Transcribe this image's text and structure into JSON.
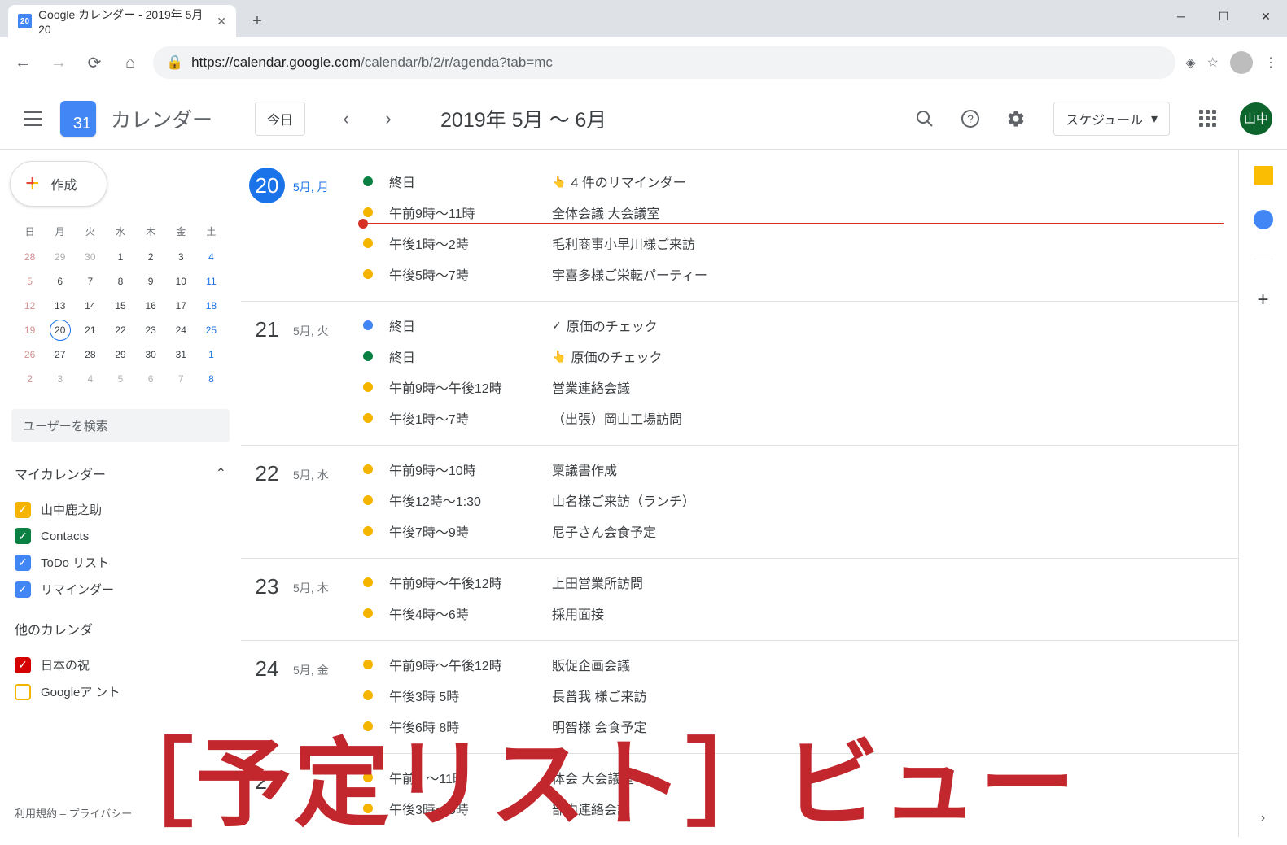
{
  "browser": {
    "tab_title": "Google カレンダー - 2019年 5月 20",
    "favicon_text": "20",
    "url_host": "https://calendar.google.com",
    "url_path": "/calendar/b/2/r/agenda?tab=mc"
  },
  "header": {
    "logo_day": "31",
    "logo_text": "カレンダー",
    "today": "今日",
    "date_range": "2019年 5月 ～ 6月",
    "view_label": "スケジュール",
    "avatar_text": "山中"
  },
  "sidebar": {
    "create": "作成",
    "mini_cal": {
      "dow": [
        "日",
        "月",
        "火",
        "水",
        "木",
        "金",
        "土"
      ],
      "weeks": [
        [
          {
            "d": "28",
            "cls": "sun-other"
          },
          {
            "d": "29",
            "cls": "other"
          },
          {
            "d": "30",
            "cls": "other"
          },
          {
            "d": "1",
            "cls": ""
          },
          {
            "d": "2",
            "cls": ""
          },
          {
            "d": "3",
            "cls": ""
          },
          {
            "d": "4",
            "cls": "sat"
          }
        ],
        [
          {
            "d": "5",
            "cls": "sun-other"
          },
          {
            "d": "6",
            "cls": ""
          },
          {
            "d": "7",
            "cls": ""
          },
          {
            "d": "8",
            "cls": ""
          },
          {
            "d": "9",
            "cls": ""
          },
          {
            "d": "10",
            "cls": ""
          },
          {
            "d": "11",
            "cls": "sat"
          }
        ],
        [
          {
            "d": "12",
            "cls": "sun-other"
          },
          {
            "d": "13",
            "cls": ""
          },
          {
            "d": "14",
            "cls": ""
          },
          {
            "d": "15",
            "cls": ""
          },
          {
            "d": "16",
            "cls": ""
          },
          {
            "d": "17",
            "cls": ""
          },
          {
            "d": "18",
            "cls": "sat"
          }
        ],
        [
          {
            "d": "19",
            "cls": "sun-other"
          },
          {
            "d": "20",
            "cls": "today"
          },
          {
            "d": "21",
            "cls": ""
          },
          {
            "d": "22",
            "cls": ""
          },
          {
            "d": "23",
            "cls": ""
          },
          {
            "d": "24",
            "cls": ""
          },
          {
            "d": "25",
            "cls": "sat"
          }
        ],
        [
          {
            "d": "26",
            "cls": "sun-other"
          },
          {
            "d": "27",
            "cls": ""
          },
          {
            "d": "28",
            "cls": ""
          },
          {
            "d": "29",
            "cls": ""
          },
          {
            "d": "30",
            "cls": ""
          },
          {
            "d": "31",
            "cls": ""
          },
          {
            "d": "1",
            "cls": "sat other"
          }
        ],
        [
          {
            "d": "2",
            "cls": "sun-other"
          },
          {
            "d": "3",
            "cls": "other"
          },
          {
            "d": "4",
            "cls": "other"
          },
          {
            "d": "5",
            "cls": "other"
          },
          {
            "d": "6",
            "cls": "other"
          },
          {
            "d": "7",
            "cls": "other"
          },
          {
            "d": "8",
            "cls": "sat other"
          }
        ]
      ]
    },
    "search_placeholder": "ユーザーを検索",
    "my_calendars_label": "マイカレンダー",
    "my_calendars": [
      {
        "label": "山中鹿之助",
        "color": "#f4b400",
        "checked": true
      },
      {
        "label": "Contacts",
        "color": "#0b8043",
        "checked": true
      },
      {
        "label": "ToDo リスト",
        "color": "#4285f4",
        "checked": true
      },
      {
        "label": "リマインダー",
        "color": "#4285f4",
        "checked": true
      }
    ],
    "other_calendars_label": "他のカレンダ",
    "other_calendars": [
      {
        "label": "日本の祝",
        "color": "#d50000",
        "checked": true
      },
      {
        "label": "Googleア        ント",
        "color": "#f4b400",
        "checked": false
      }
    ],
    "terms": "利用規約 – プライバシー"
  },
  "agenda": [
    {
      "day": "20",
      "label": "5月, 月",
      "selected": true,
      "events": [
        {
          "color": "#0b8043",
          "time": "終日",
          "title": "4 件のリマインダー",
          "icon": "👆"
        },
        {
          "color": "#f4b400",
          "time": "午前9時～11時",
          "title": "全体会議 大会議室"
        },
        {
          "now_line": true
        },
        {
          "color": "#f4b400",
          "time": "午後1時～2時",
          "title": "毛利商事小早川様ご来訪"
        },
        {
          "color": "#f4b400",
          "time": "午後5時～7時",
          "title": "宇喜多様ご栄転パーティー"
        }
      ]
    },
    {
      "day": "21",
      "label": "5月, 火",
      "events": [
        {
          "color": "#4285f4",
          "time": "終日",
          "title": "原価のチェック",
          "icon": "✓"
        },
        {
          "color": "#0b8043",
          "time": "終日",
          "title": "原価のチェック",
          "icon": "👆"
        },
        {
          "color": "#f4b400",
          "time": "午前9時～午後12時",
          "title": "営業連絡会議"
        },
        {
          "color": "#f4b400",
          "time": "午後1時～7時",
          "title": "（出張）岡山工場訪問"
        }
      ]
    },
    {
      "day": "22",
      "label": "5月, 水",
      "events": [
        {
          "color": "#f4b400",
          "time": "午前9時～10時",
          "title": "稟議書作成"
        },
        {
          "color": "#f4b400",
          "time": "午後12時～1:30",
          "title": "山名様ご来訪（ランチ）"
        },
        {
          "color": "#f4b400",
          "time": "午後7時～9時",
          "title": "尼子さん会食予定"
        }
      ]
    },
    {
      "day": "23",
      "label": "5月, 木",
      "events": [
        {
          "color": "#f4b400",
          "time": "午前9時～午後12時",
          "title": "上田営業所訪問"
        },
        {
          "color": "#f4b400",
          "time": "午後4時～6時",
          "title": "採用面接"
        }
      ]
    },
    {
      "day": "24",
      "label": "5月, 金",
      "events": [
        {
          "color": "#f4b400",
          "time": "午前9時～午後12時",
          "title": "販促企画会議"
        },
        {
          "color": "#f4b400",
          "time": "午後3時    5時",
          "title": "長曾我   様ご来訪"
        },
        {
          "color": "#f4b400",
          "time": "午後6時   8時",
          "title": "明智様   会食予定"
        }
      ]
    },
    {
      "day": "27",
      "label": "",
      "events": [
        {
          "color": "#f4b400",
          "time": "午前9    ～11時",
          "title": "  体会    大会議室"
        },
        {
          "color": "#f4b400",
          "time": "午後3時～5時",
          "title": "部内連絡会議"
        }
      ]
    }
  ],
  "overlay": "［予定リスト］ビュー"
}
